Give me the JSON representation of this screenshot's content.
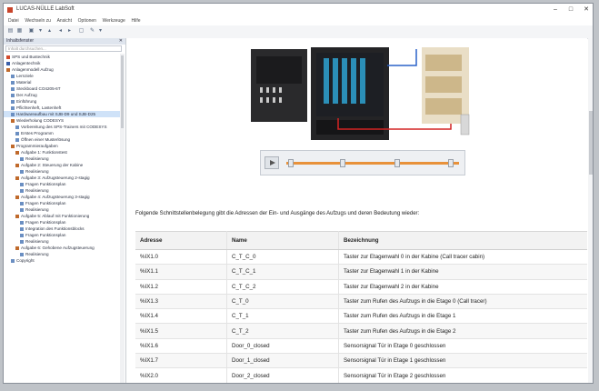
{
  "window": {
    "title": "LUCAS-NÜLLE LabSoft"
  },
  "menu": [
    "Datei",
    "Wechseln zu",
    "Ansicht",
    "Optionen",
    "Werkzeuge",
    "Hilfe"
  ],
  "sidebar": {
    "header": "Inhaltsfenster",
    "search_placeholder": "Inhalt durchsuchen...",
    "items": [
      {
        "label": "SPS und Bustechnik",
        "level": 0,
        "color": "#d24a2c"
      },
      {
        "label": "Anlagentechnik",
        "level": 0,
        "color": "#3b5fa8"
      },
      {
        "label": "Anlagenmodell Aufzug",
        "level": 0,
        "color": "#c06a2c"
      },
      {
        "label": "Lernziele",
        "level": 1,
        "color": "#6b8fc2"
      },
      {
        "label": "Material",
        "level": 1,
        "color": "#6b8fc2"
      },
      {
        "label": "Steckboard CO4205-6T",
        "level": 1,
        "color": "#6b8fc2"
      },
      {
        "label": "Der Aufzug",
        "level": 1,
        "color": "#6b8fc2"
      },
      {
        "label": "Einführung",
        "level": 1,
        "color": "#6b8fc2"
      },
      {
        "label": "Pflichtenheft, Lastenheft",
        "level": 1,
        "color": "#6b8fc2"
      },
      {
        "label": "Hardwareaufbau mit SJB-D9 und SJB-D25",
        "level": 1,
        "color": "#6b8fc2",
        "selected": true
      },
      {
        "label": "Wiederholung CODESYS",
        "level": 1,
        "color": "#c06a2c"
      },
      {
        "label": "Vorbereitung des SPS-Trainers mit CODESYS",
        "level": 2,
        "color": "#6b8fc2"
      },
      {
        "label": "Erstes Programm",
        "level": 2,
        "color": "#6b8fc2"
      },
      {
        "label": "Öffnen einer Musterlösung",
        "level": 2,
        "color": "#6b8fc2"
      },
      {
        "label": "Programmieraufgaben",
        "level": 1,
        "color": "#c06a2c"
      },
      {
        "label": "Aufgabe 1: Funktionstest",
        "level": 2,
        "color": "#c06a2c"
      },
      {
        "label": "Realisierung",
        "level": 3,
        "color": "#6b8fc2"
      },
      {
        "label": "Aufgabe 2: Steuerung der Kabine",
        "level": 2,
        "color": "#c06a2c"
      },
      {
        "label": "Realisierung",
        "level": 3,
        "color": "#6b8fc2"
      },
      {
        "label": "Aufgabe 3: Aufzugsteuerung 2-stagig",
        "level": 2,
        "color": "#c06a2c"
      },
      {
        "label": "Fragen Funktionsplan",
        "level": 3,
        "color": "#6b8fc2"
      },
      {
        "label": "Realisierung",
        "level": 3,
        "color": "#6b8fc2"
      },
      {
        "label": "Aufgabe 4: Aufzugsteuerung 3-stagig",
        "level": 2,
        "color": "#c06a2c"
      },
      {
        "label": "Fragen Funktionsplan",
        "level": 3,
        "color": "#6b8fc2"
      },
      {
        "label": "Realisierung",
        "level": 3,
        "color": "#6b8fc2"
      },
      {
        "label": "Aufgabe 5: Ablauf mit Funktionierung",
        "level": 2,
        "color": "#c06a2c"
      },
      {
        "label": "Fragen Funktionsplan",
        "level": 3,
        "color": "#6b8fc2"
      },
      {
        "label": "Integration des Funktionsblocks",
        "level": 3,
        "color": "#6b8fc2"
      },
      {
        "label": "Fragen Funktionsplan",
        "level": 3,
        "color": "#6b8fc2"
      },
      {
        "label": "Realisierung",
        "level": 3,
        "color": "#6b8fc2"
      },
      {
        "label": "Aufgabe 6: Gehobene Aufzugsteuerung",
        "level": 2,
        "color": "#c06a2c"
      },
      {
        "label": "Realisierung",
        "level": 3,
        "color": "#6b8fc2"
      },
      {
        "label": "Copyright",
        "level": 1,
        "color": "#6b8fc2"
      }
    ]
  },
  "content": {
    "intro": "Folgende Schnittstellenbelegung gibt die Adressen der Ein- und Ausgänge des Aufzugs und deren Bedeutung wieder:",
    "table": {
      "headers": [
        "Adresse",
        "Name",
        "Bezeichnung"
      ],
      "rows": [
        [
          "%IX1.0",
          "C_T_C_0",
          "Taster zur Etagenwahl 0 in der Kabine (Call tracer cabin)"
        ],
        [
          "%IX1.1",
          "C_T_C_1",
          "Taster zur Etagenwahl 1 in der Kabine"
        ],
        [
          "%IX1.2",
          "C_T_C_2",
          "Taster zur Etagenwahl 2 in der Kabine"
        ],
        [
          "%IX1.3",
          "C_T_0",
          "Taster zum Rufen des Aufzugs in die Etage 0 (Call tracer)"
        ],
        [
          "%IX1.4",
          "C_T_1",
          "Taster zum Rufen des Aufzugs in die Etage 1"
        ],
        [
          "%IX1.5",
          "C_T_2",
          "Taster zum Rufen des Aufzugs in die Etage 2"
        ],
        [
          "%IX1.6",
          "Door_0_closed",
          "Sensorsignal Tür in Etage 0 geschlossen"
        ],
        [
          "%IX1.7",
          "Door_1_closed",
          "Sensorsignal Tür in Etage 1 geschlossen"
        ],
        [
          "%IX2.0",
          "Door_2_closed",
          "Sensorsignal Tür in Etage 2 geschlossen"
        ]
      ]
    },
    "player": {
      "progress": 0.0
    }
  },
  "colors": {
    "accent": "#e8913a",
    "selection": "#cfe2f8"
  }
}
